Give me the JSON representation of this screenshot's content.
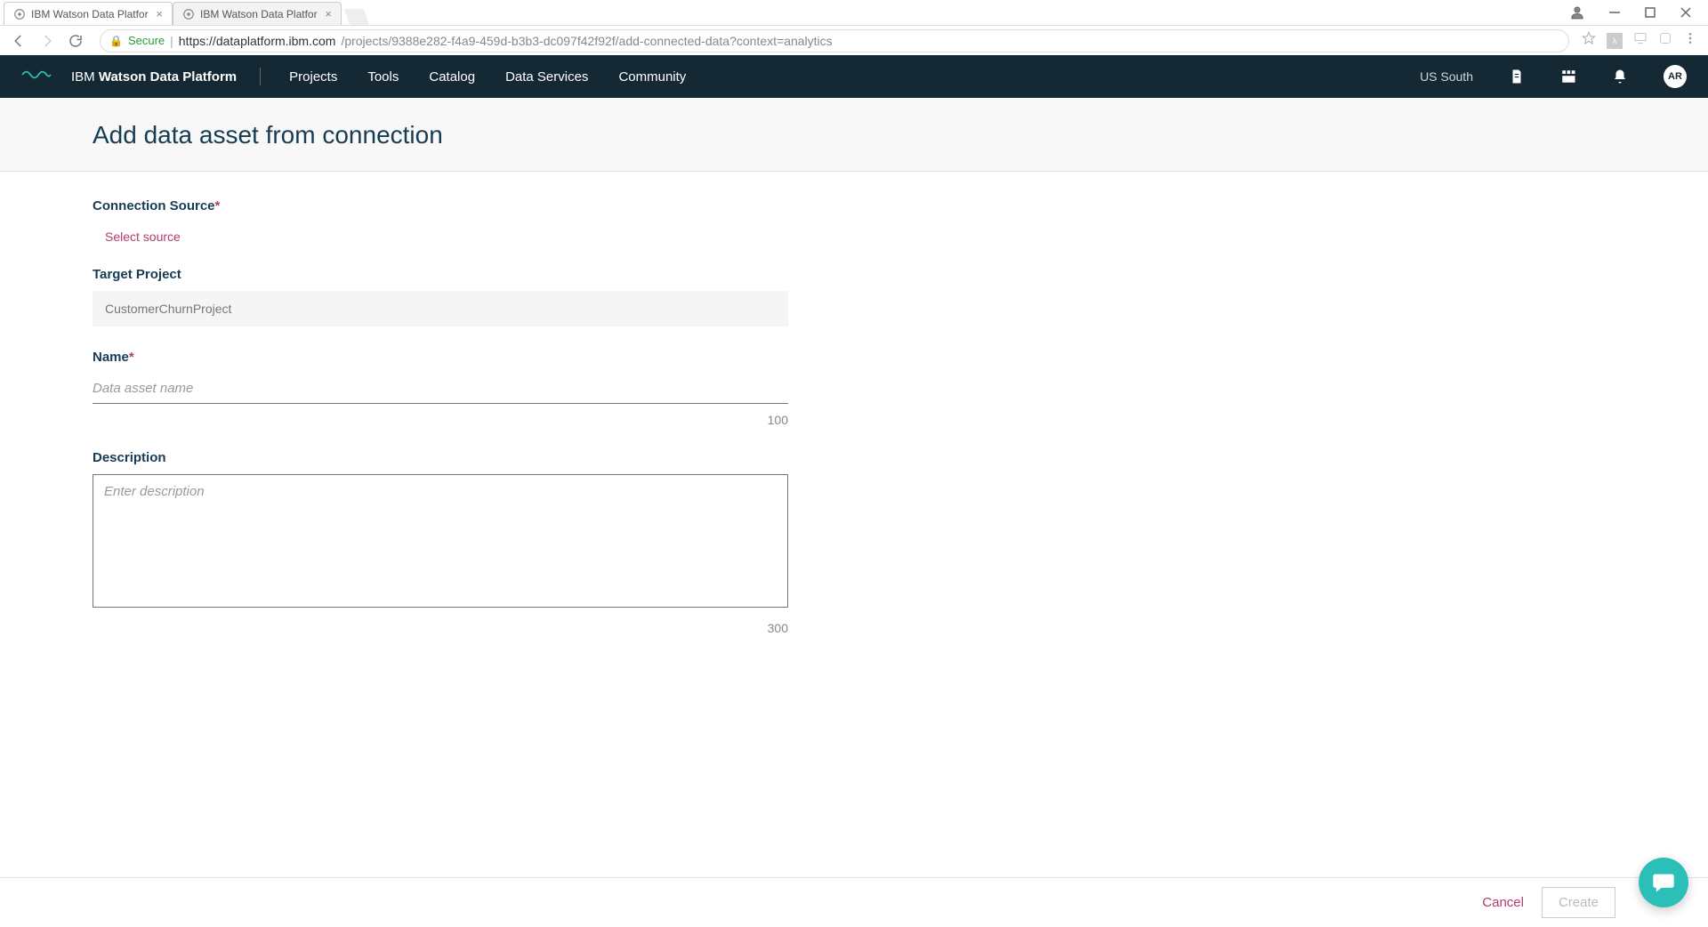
{
  "browser": {
    "tabs": [
      {
        "title": "IBM Watson Data Platfor"
      },
      {
        "title": "IBM Watson Data Platfor"
      }
    ],
    "secure_label": "Secure",
    "url_host": "https://dataplatform.ibm.com",
    "url_path": "/projects/9388e282-f4a9-459d-b3b3-dc097f42f92f/add-connected-data?context=analytics"
  },
  "header": {
    "brand_prefix": "IBM ",
    "brand_bold": "Watson Data Platform",
    "nav": [
      "Projects",
      "Tools",
      "Catalog",
      "Data Services",
      "Community"
    ],
    "region": "US South",
    "avatar_initials": "AR"
  },
  "page": {
    "title": "Add data asset from connection"
  },
  "form": {
    "connection_source": {
      "label": "Connection Source",
      "select_text": "Select source"
    },
    "target_project": {
      "label": "Target Project",
      "value": "CustomerChurnProject"
    },
    "name": {
      "label": "Name",
      "placeholder": "Data asset name",
      "value": "",
      "max": "100"
    },
    "description": {
      "label": "Description",
      "placeholder": "Enter description",
      "value": "",
      "max": "300"
    }
  },
  "footer": {
    "cancel": "Cancel",
    "create": "Create"
  }
}
